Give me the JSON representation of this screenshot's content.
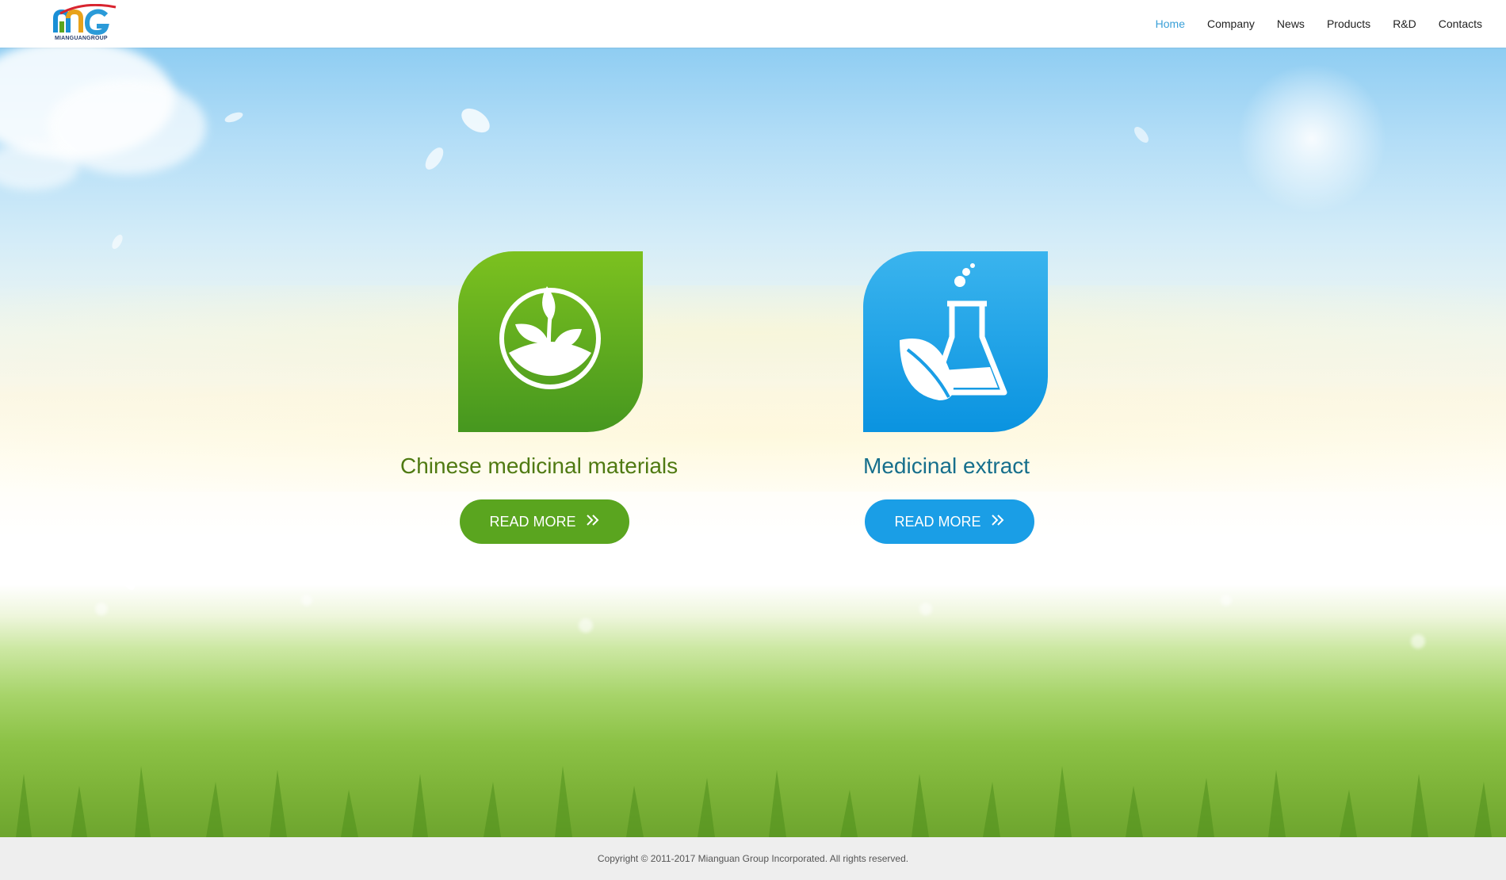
{
  "header": {
    "logo_text": "MIANGUANGROUP",
    "nav": [
      {
        "label": "Home",
        "active": true
      },
      {
        "label": "Company",
        "active": false
      },
      {
        "label": "News",
        "active": false
      },
      {
        "label": "Products",
        "active": false
      },
      {
        "label": "R&D",
        "active": false
      },
      {
        "label": "Contacts",
        "active": false
      }
    ]
  },
  "cards": [
    {
      "title": "Chinese medicinal materials",
      "button": "READ MORE",
      "icon": "plant-sprout-icon",
      "color": "#5aa51f"
    },
    {
      "title": "Medicinal extract",
      "button": "READ MORE",
      "icon": "flask-leaf-icon",
      "color": "#1a9ee6"
    }
  ],
  "footer": {
    "copyright": "Copyright © 2011-2017 Mianguan Group Incorporated. All rights reserved."
  },
  "colors": {
    "nav_active": "#3aa0d8",
    "green_title": "#4f7a12",
    "blue_title": "#166f8c",
    "footer_bg": "#eeeeee"
  }
}
